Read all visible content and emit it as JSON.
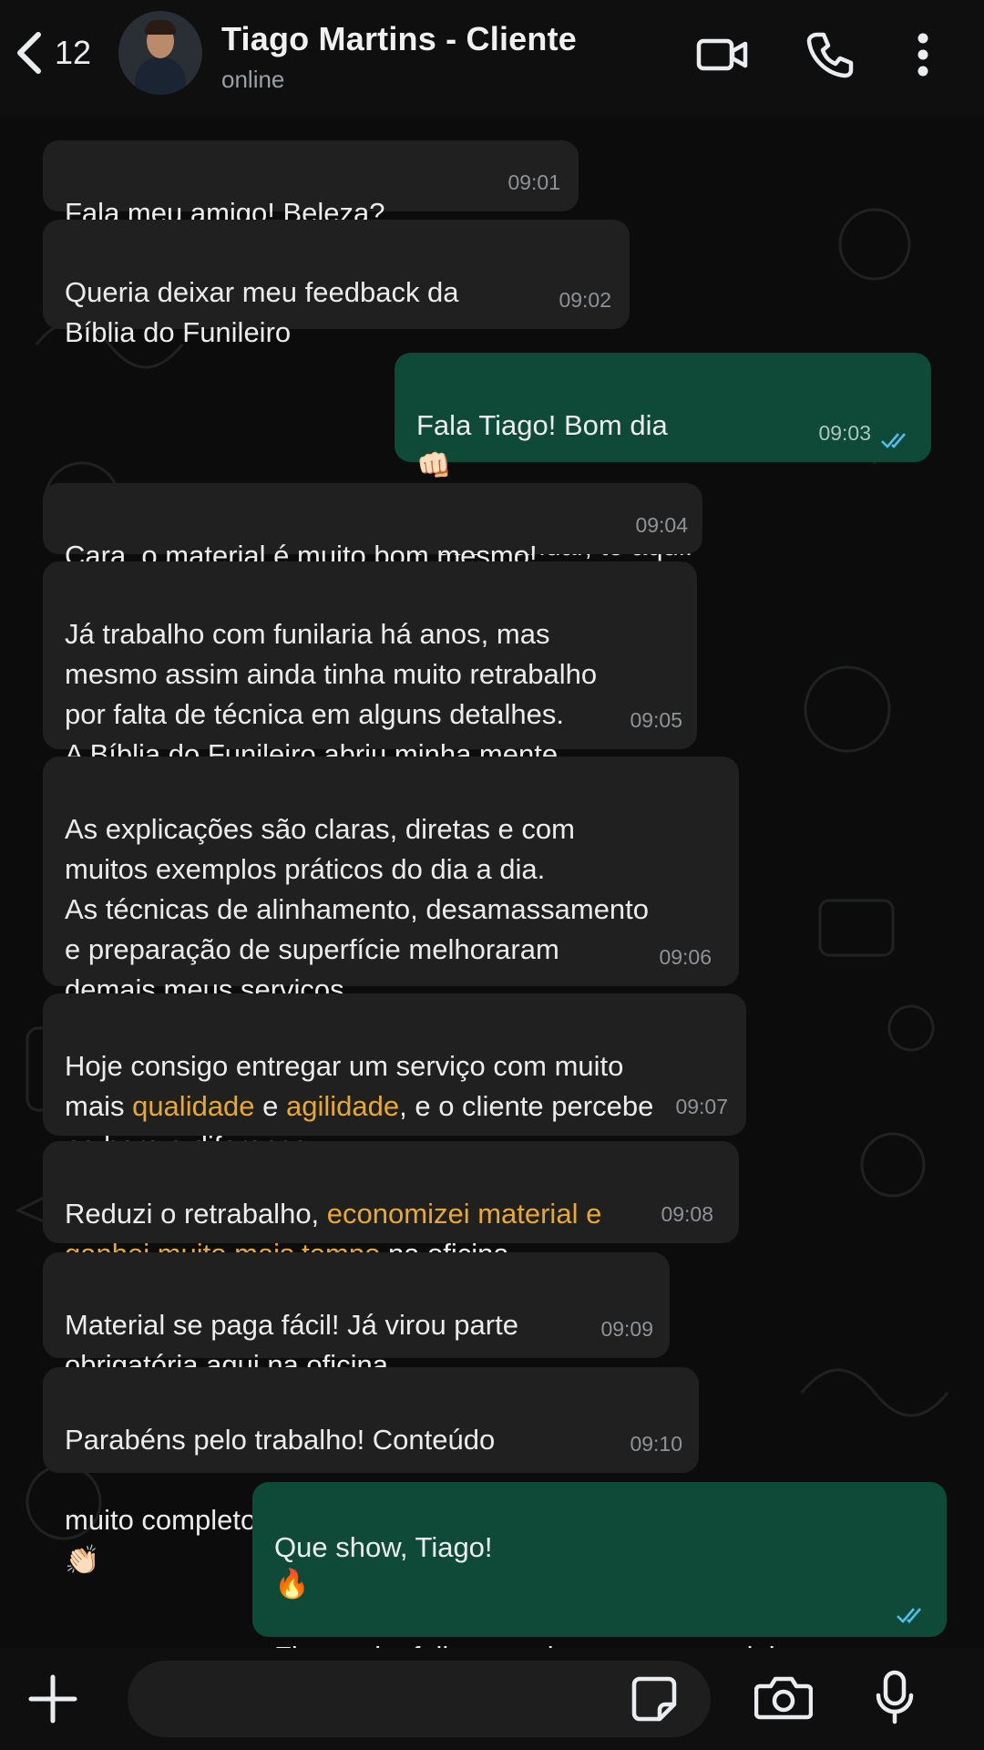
{
  "header": {
    "back_count": "12",
    "contact_name": "Tiago Martins - Cliente",
    "status": "online",
    "icons": [
      "chevron-left-icon",
      "video-call-icon",
      "phone-icon",
      "more-vertical-icon"
    ]
  },
  "messages": [
    {
      "dir": "in",
      "text": "Fala meu amigo! Beleza?",
      "time": "09:01"
    },
    {
      "dir": "in",
      "text": "Queria deixar meu feedback da\nBíblia do Funileiro",
      "time": "09:02"
    },
    {
      "dir": "out",
      "line1": "Fala Tiago! Bom dia",
      "emoji1": "👊🏻",
      "line2": "Pode mandar, tô aqui!",
      "time": "09:03",
      "read": true
    },
    {
      "dir": "in",
      "text": "Cara, o material é muito bom mesmo!",
      "time": "09:04"
    },
    {
      "dir": "in",
      "text": "Já trabalho com funilaria há anos, mas\nmesmo assim ainda tinha muito retrabalho\npor falta de técnica em alguns detalhes.\nA Bíblia do Funileiro abriu minha mente.",
      "time": "09:05"
    },
    {
      "dir": "in",
      "text": "As explicações são claras, diretas e com\nmuitos exemplos práticos do dia a dia.\nAs técnicas de alinhamento, desamassamento\ne preparação de superfície melhoraram\ndemais meus serviços.",
      "time": "09:06"
    },
    {
      "dir": "in",
      "p1": "Hoje consigo entregar um serviço com muito\nmais ",
      "h1": "qualidade",
      "p2": " e ",
      "h2": "agilidade",
      "p3": ", e o cliente percebe\nna hora a diferença.",
      "time": "09:07"
    },
    {
      "dir": "in",
      "p1": "Reduzi o retrabalho, ",
      "h1": "economizei material e\nganhei muito mais tempo",
      "p2": " na oficina.",
      "time": "09:08"
    },
    {
      "dir": "in",
      "text": "Material se paga fácil! Já virou parte\nobrigatória aqui na oficina.",
      "time": "09:09"
    },
    {
      "dir": "in",
      "line1": "Parabéns pelo trabalho! Conteúdo",
      "line2": "muito completo e direto ao ponto!",
      "emoji": "👏🏻",
      "time": "09:10"
    },
    {
      "dir": "out",
      "line1": "Que show, Tiago!",
      "emoji1": "🔥",
      "body": "Fico muito feliz em saber que o material\nestá te ajudando a entregar mais qualidade,\nagilidade e lucro na funilaria! Sucesso sempre!",
      "emoji2": "🚀",
      "read": true
    }
  ],
  "input_bar": {
    "icons": [
      "plus-icon",
      "sticker-icon",
      "camera-icon",
      "microphone-icon"
    ]
  },
  "colors": {
    "incoming_bubble": "#202020",
    "outgoing_bubble": "#0f4a39",
    "highlight": "#e9a931",
    "read_ticks": "#53bdeb"
  }
}
